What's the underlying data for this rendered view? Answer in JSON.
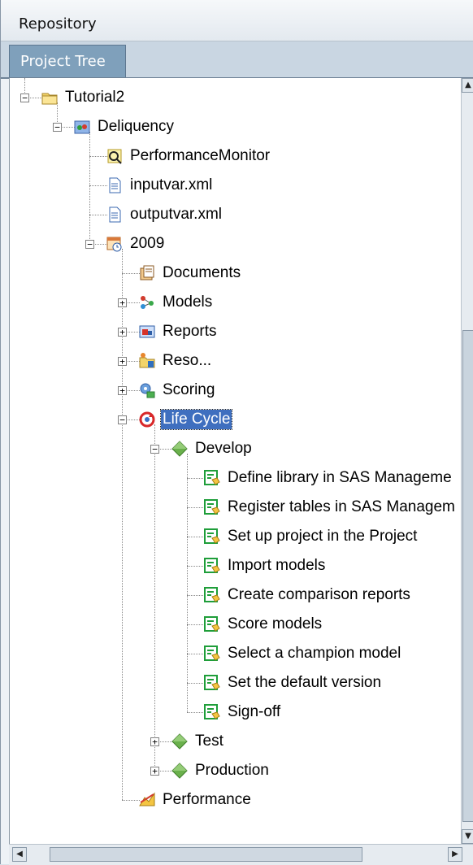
{
  "header": {
    "title": "Repository"
  },
  "tabs": [
    {
      "label": "Project Tree",
      "active": true
    }
  ],
  "tree": [
    {
      "label": "Tutorial2",
      "icon": "folder-icon",
      "level": 0,
      "toggle": "-",
      "last": true
    },
    {
      "label": "Deliquency",
      "icon": "project-icon",
      "level": 1,
      "toggle": "-",
      "last": true
    },
    {
      "label": "PerformanceMonitor",
      "icon": "performance-monitor-icon",
      "level": 2,
      "toggle": null
    },
    {
      "label": "inputvar.xml",
      "icon": "document-icon",
      "level": 2,
      "toggle": null
    },
    {
      "label": "outputvar.xml",
      "icon": "document-icon",
      "level": 2,
      "toggle": null
    },
    {
      "label": "2009",
      "icon": "calendar-version-icon",
      "level": 2,
      "toggle": "-",
      "last": true
    },
    {
      "label": "Documents",
      "icon": "documents-icon",
      "level": 3,
      "toggle": null
    },
    {
      "label": "Models",
      "icon": "models-icon",
      "level": 3,
      "toggle": "+"
    },
    {
      "label": "Reports",
      "icon": "reports-icon",
      "level": 3,
      "toggle": "+"
    },
    {
      "label": "Reso...",
      "icon": "resources-icon",
      "level": 3,
      "toggle": "+"
    },
    {
      "label": "Scoring",
      "icon": "scoring-icon",
      "level": 3,
      "toggle": "+"
    },
    {
      "label": "Life Cycle",
      "icon": "life-cycle-icon",
      "level": 3,
      "toggle": "-",
      "selected": true
    },
    {
      "label": "Develop",
      "icon": "milestone-icon",
      "level": 4,
      "toggle": "-"
    },
    {
      "label": "Define library in SAS Manageme",
      "icon": "task-icon",
      "level": 5,
      "toggle": null
    },
    {
      "label": "Register tables in SAS Managem",
      "icon": "task-icon",
      "level": 5,
      "toggle": null
    },
    {
      "label": "Set up project in the Project",
      "icon": "task-icon",
      "level": 5,
      "toggle": null
    },
    {
      "label": "Import models",
      "icon": "task-icon",
      "level": 5,
      "toggle": null
    },
    {
      "label": "Create comparison reports",
      "icon": "task-icon",
      "level": 5,
      "toggle": null
    },
    {
      "label": "Score models",
      "icon": "task-icon",
      "level": 5,
      "toggle": null
    },
    {
      "label": "Select a champion model",
      "icon": "task-icon",
      "level": 5,
      "toggle": null
    },
    {
      "label": "Set the default version",
      "icon": "task-icon",
      "level": 5,
      "toggle": null
    },
    {
      "label": "Sign-off",
      "icon": "task-icon",
      "level": 5,
      "toggle": null,
      "last": true
    },
    {
      "label": "Test",
      "icon": "milestone-icon",
      "level": 4,
      "toggle": "+"
    },
    {
      "label": "Production",
      "icon": "milestone-icon",
      "level": 4,
      "toggle": "+",
      "last": true
    },
    {
      "label": "Performance",
      "icon": "performance-icon",
      "level": 3,
      "toggle": null,
      "last": true
    }
  ],
  "colors": {
    "selection": "#3f6fbf",
    "tab_active": "#7fa0bb",
    "milestone": "#6ab04c",
    "task": "#1f9e3a"
  }
}
